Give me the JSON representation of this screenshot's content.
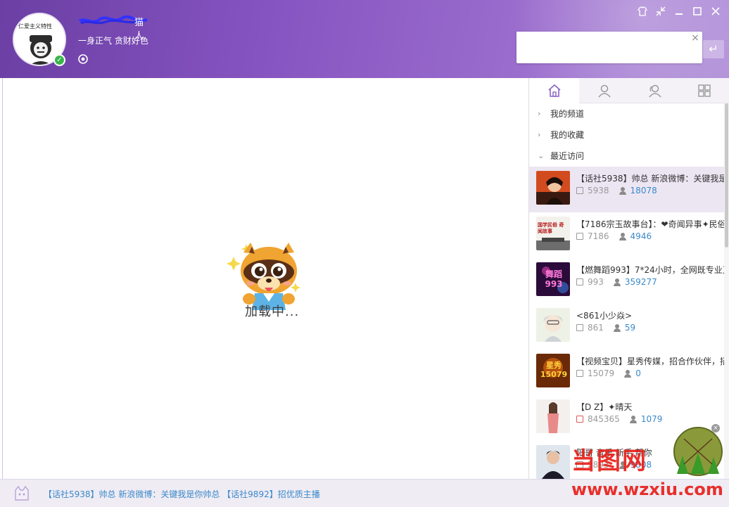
{
  "header": {
    "username_tail": "猫人",
    "signature": "一身正气 贪财好色",
    "avatar_text": "仁爱主义特性",
    "controls": [
      "shirt-icon",
      "shrink-icon",
      "minimize-icon",
      "maximize-icon",
      "close-icon"
    ]
  },
  "search": {
    "value": "",
    "placeholder": "",
    "clear_label": "×",
    "enter_label": "↵"
  },
  "main": {
    "loading_text": "加载中..."
  },
  "panel": {
    "tabs": [
      "home-icon",
      "user-icon",
      "users-icon",
      "apps-icon"
    ],
    "nav": [
      {
        "label": "我的频道",
        "expanded": false
      },
      {
        "label": "我的收藏",
        "expanded": false
      },
      {
        "label": "最近访问",
        "expanded": true
      }
    ],
    "rooms": [
      {
        "title": "【话社5938】帅总 新浪微博：关键我是",
        "id": "5938",
        "count": "18078",
        "thumb_text": ""
      },
      {
        "title": "【7186宗玉故事台】：❤奇闻异事✦民俗",
        "id": "7186",
        "count": "4946",
        "thumb_text": "国学民俗 奇闻故事"
      },
      {
        "title": "【燃舞蹈993】7*24小时，全网既专业又",
        "id": "993",
        "count": "359277",
        "thumb_text": "舞蹈 993"
      },
      {
        "title": "<861小少焱>",
        "id": "861",
        "count": "59",
        "thumb_text": ""
      },
      {
        "title": "【视频宝贝】星秀传媒，招合作伙伴，招",
        "id": "15079",
        "count": "0",
        "thumb_text": "星秀 15079"
      },
      {
        "title": "【D Z】✦晴天",
        "id": "845365",
        "count": "1079",
        "thumb_text": ""
      },
      {
        "title": "阳哥 音乐 新手 帮你",
        "id": "2893",
        "count": "9808",
        "thumb_text": ""
      }
    ]
  },
  "bottom": {
    "ticker": "【话社5938】帅总 新浪微博：关键我是你帅总 【话社9892】招优质主播"
  },
  "watermark": {
    "cn": "当图网",
    "url": "www.wzxiu.com",
    "close_label": "×"
  }
}
